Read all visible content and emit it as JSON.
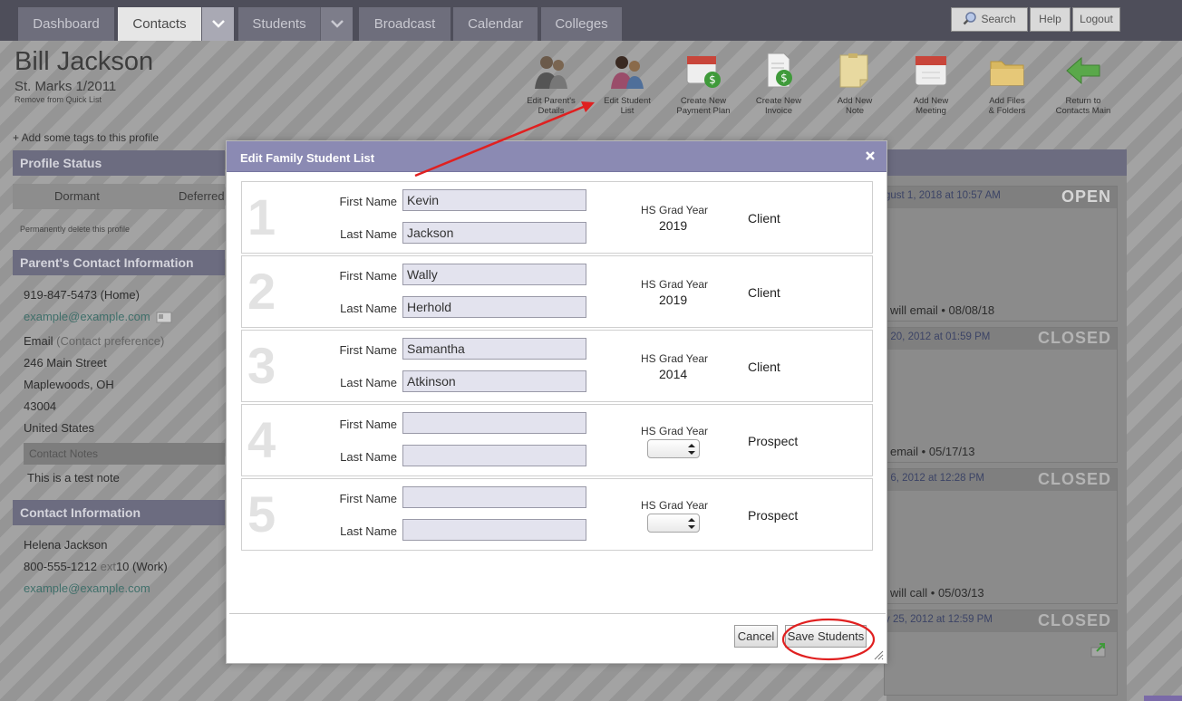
{
  "nav": {
    "tabs": [
      "Dashboard",
      "Contacts",
      "Students",
      "Broadcast",
      "Calendar",
      "Colleges"
    ],
    "search_label": "Search",
    "help_label": "Help",
    "logout_label": "Logout"
  },
  "profile": {
    "name": "Bill Jackson",
    "subtitle": "St. Marks 1/2011",
    "remove_link": "Remove from Quick List",
    "tags_link": "+ Add some tags to this profile"
  },
  "toolbar": [
    {
      "line1": "Edit Parent's",
      "line2": "Details"
    },
    {
      "line1": "Edit Student",
      "line2": "List"
    },
    {
      "line1": "Create New",
      "line2": "Payment Plan"
    },
    {
      "line1": "Create New",
      "line2": "Invoice"
    },
    {
      "line1": "Add New",
      "line2": "Note"
    },
    {
      "line1": "Add New",
      "line2": "Meeting"
    },
    {
      "line1": "Add Files",
      "line2": "& Folders"
    },
    {
      "line1": "Return to",
      "line2": "Contacts Main"
    }
  ],
  "left": {
    "profile_status_title": "Profile Status",
    "dormant": "Dormant",
    "deferred": "Deferred",
    "delete_link": "Permanently delete this profile",
    "parent_title": "Parent's Contact Information",
    "phone": "919-847-5473 (Home)",
    "email": "example@example.com",
    "email_pref": "Email",
    "email_pref_note": "(Contact preference)",
    "street": "246 Main Street",
    "city": "Maplewoods, OH",
    "zip": "43004",
    "country": "United States",
    "notes_title": "Contact Notes",
    "note": "This is a test note",
    "contact_title": "Contact Information",
    "contact_name": "Helena Jackson",
    "contact_phone_main": "800-555-1212",
    "contact_phone_ext": "ext",
    "contact_phone_rest": "10 (Work)",
    "contact_email": "example@example.com"
  },
  "right": {
    "cards": [
      {
        "date": "gust 1, 2018 at 10:57 AM",
        "status": "OPEN",
        "foot": "will email  • 08/08/18"
      },
      {
        "date": "t 20, 2012 at 01:59 PM",
        "status": "CLOSED",
        "foot": "email  • 05/17/13"
      },
      {
        "date": "t 6, 2012 at 12:28 PM",
        "status": "CLOSED",
        "foot": "will call  • 05/03/13"
      },
      {
        "date": "y 25, 2012 at 12:59 PM",
        "status": "CLOSED",
        "foot": ""
      }
    ]
  },
  "modal": {
    "title": "Edit Family Student List",
    "first_label": "First Name",
    "last_label": "Last Name",
    "grad_label": "HS Grad Year",
    "students": [
      {
        "num": "1",
        "first": "Kevin",
        "last": "Jackson",
        "grad": "2019",
        "status": "Client"
      },
      {
        "num": "2",
        "first": "Wally",
        "last": "Herhold",
        "grad": "2019",
        "status": "Client"
      },
      {
        "num": "3",
        "first": "Samantha",
        "last": "Atkinson",
        "grad": "2014",
        "status": "Client"
      },
      {
        "num": "4",
        "first": "",
        "last": "",
        "grad": "",
        "status": "Prospect"
      },
      {
        "num": "5",
        "first": "",
        "last": "",
        "grad": "",
        "status": "Prospect"
      }
    ],
    "cancel_label": "Cancel",
    "save_label": "Save Students"
  },
  "colors": {
    "modal_header": "#8b8ab3",
    "section_header": "#6c6c80",
    "input_bg": "#e3e3ee",
    "annotation_red": "#e02020"
  }
}
